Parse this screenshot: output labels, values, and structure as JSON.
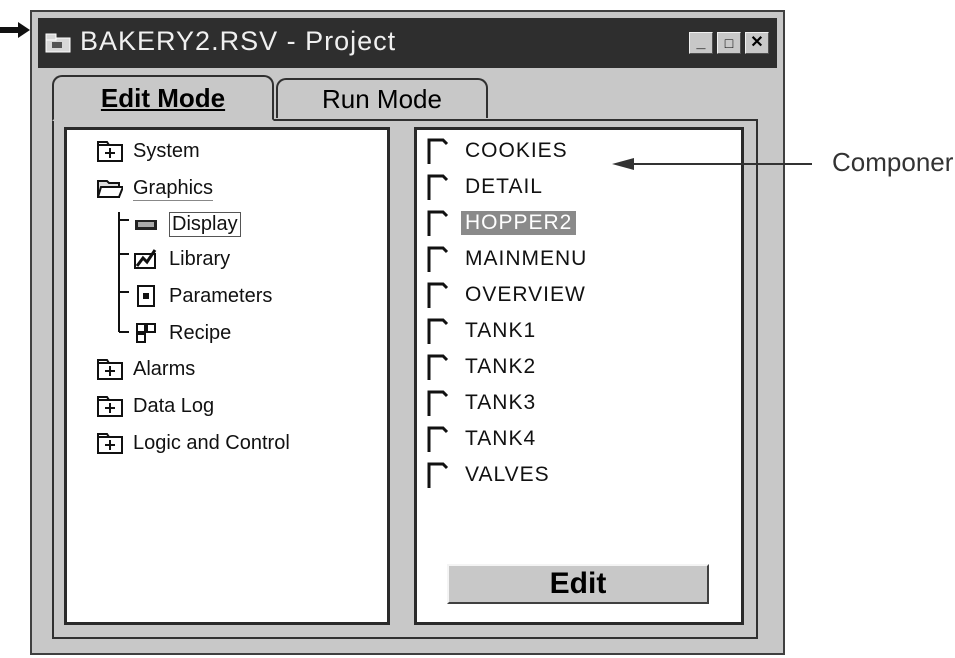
{
  "window": {
    "title": "BAKERY2.RSV - Project",
    "buttons": {
      "minimize": "_",
      "maximize": "□",
      "close": "✕"
    }
  },
  "tabs": [
    {
      "label": "Edit Mode",
      "active": true
    },
    {
      "label": "Run Mode",
      "active": false
    }
  ],
  "tree": {
    "items": [
      {
        "label": "System",
        "icon": "folder-plus-icon"
      },
      {
        "label": "Graphics",
        "icon": "folder-open-icon"
      },
      {
        "label": "Display",
        "icon": "display-icon",
        "selected": true
      },
      {
        "label": "Library",
        "icon": "library-icon"
      },
      {
        "label": "Parameters",
        "icon": "parameters-icon"
      },
      {
        "label": "Recipe",
        "icon": "recipe-icon"
      },
      {
        "label": "Alarms",
        "icon": "folder-plus-icon"
      },
      {
        "label": "Data Log",
        "icon": "folder-plus-icon"
      },
      {
        "label": "Logic and Control",
        "icon": "folder-plus-icon"
      }
    ]
  },
  "files": {
    "items": [
      {
        "label": "COOKIES"
      },
      {
        "label": "DETAIL"
      },
      {
        "label": "HOPPER2",
        "selected": true
      },
      {
        "label": "MAINMENU"
      },
      {
        "label": "OVERVIEW"
      },
      {
        "label": "TANK1"
      },
      {
        "label": "TANK2"
      },
      {
        "label": "TANK3"
      },
      {
        "label": "TANK4"
      },
      {
        "label": "VALVES"
      }
    ],
    "edit_button": "Edit"
  },
  "callout": {
    "label": "Componer"
  },
  "colors": {
    "titlebar": "#2e2e2e",
    "face": "#c8c8c8",
    "selection": "#8a8a8a"
  }
}
